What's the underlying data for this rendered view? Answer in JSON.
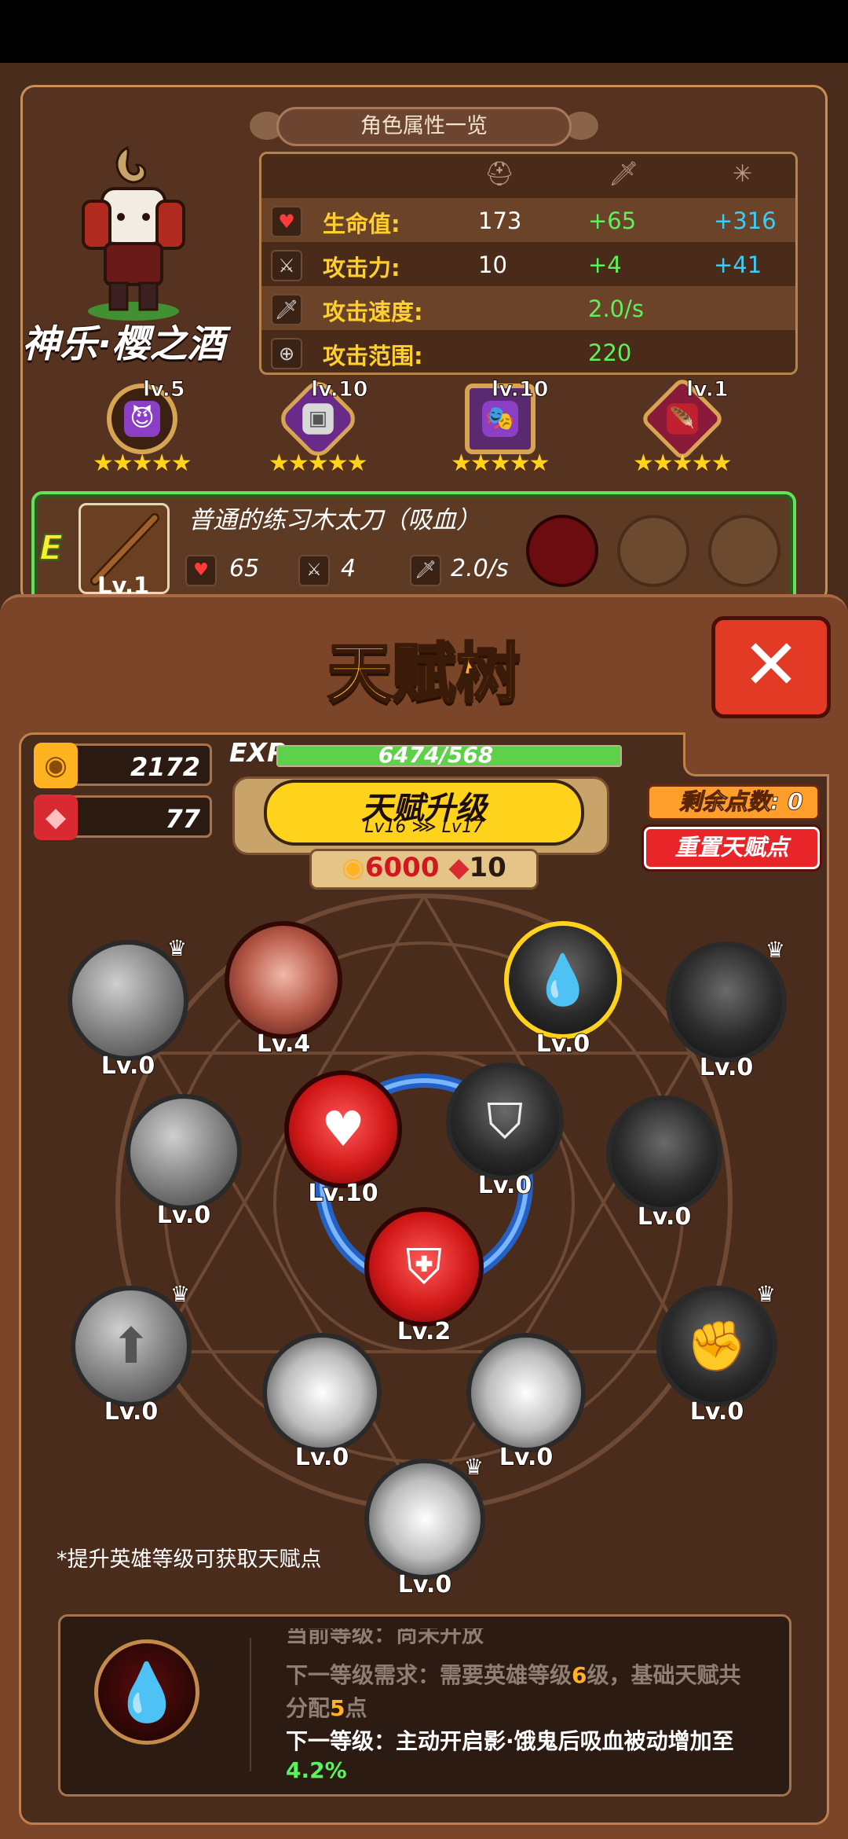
{
  "panel_title": "角色属性一览",
  "hero": {
    "name": "神乐·樱之酒"
  },
  "stats": [
    {
      "label": "生命值:",
      "base": "173",
      "bonus_green": "+65",
      "bonus_blue": "+316",
      "icon": "heart-icon"
    },
    {
      "label": "攻击力:",
      "base": "10",
      "bonus_green": "+4",
      "bonus_blue": "+41",
      "icon": "sword-icon"
    },
    {
      "label": "攻击速度:",
      "base": "",
      "bonus_green": "2.0/s",
      "bonus_blue": "",
      "icon": "sword-speed-icon"
    },
    {
      "label": "攻击范围:",
      "base": "",
      "bonus_green": "220",
      "bonus_blue": "",
      "icon": "crosshair-icon"
    }
  ],
  "equipment": [
    {
      "level": "lv.5",
      "stars": "★★★★★"
    },
    {
      "level": "lv.10",
      "stars": "★★★★★"
    },
    {
      "level": "lv.10",
      "stars": "★★★★★"
    },
    {
      "level": "lv.1",
      "stars": "★★★★★"
    }
  ],
  "weapon": {
    "grade": "E",
    "name": "普通的练习木太刀（吸血）",
    "level": "Lv.1",
    "hp": "65",
    "atk": "4",
    "speed": "2.0/s"
  },
  "talent": {
    "title": "天赋树",
    "close_label": "✕",
    "gold": "2172",
    "gems": "77",
    "exp_label": "EXP",
    "exp_text": "6474/568",
    "exp_fill": 1.0,
    "upgrade_title": "天赋升级",
    "upgrade_from": "Lv16",
    "upgrade_arrow": "⋙",
    "upgrade_to": "Lv17",
    "cost_gold": "6000",
    "cost_gems": "10",
    "remaining_label": "剩余点数:",
    "remaining_value": "0",
    "reset_label": "重置天赋点",
    "hint": "*提升英雄等级可获取天赋点"
  },
  "nodes": [
    {
      "id": "n1",
      "level": "Lv.0"
    },
    {
      "id": "n2",
      "level": "Lv.4"
    },
    {
      "id": "n3",
      "level": "Lv.0"
    },
    {
      "id": "n4",
      "level": "Lv.0"
    },
    {
      "id": "n5",
      "level": "Lv.0"
    },
    {
      "id": "n6",
      "level": "Lv.10"
    },
    {
      "id": "n7",
      "level": "Lv.0"
    },
    {
      "id": "n8",
      "level": "Lv.0"
    },
    {
      "id": "n9",
      "level": "Lv.2"
    },
    {
      "id": "n10",
      "level": "Lv.0"
    },
    {
      "id": "n11",
      "level": "Lv.0"
    },
    {
      "id": "n12",
      "level": "Lv.0"
    },
    {
      "id": "n13",
      "level": "Lv.0"
    },
    {
      "id": "n14",
      "level": "Lv.0"
    }
  ],
  "detail": {
    "line0": "当前等级：尚未开放",
    "line1_prefix": "下一等级需求：需要英雄等级",
    "line1_num": "6",
    "line1_mid": "级，基础天赋共",
    "line2_prefix": "分配",
    "line2_num": "5",
    "line2_suffix": "点",
    "line3": "下一等级：主动开启影·饿鬼后吸血被动增加至",
    "line4": "4.2%"
  },
  "colors": {
    "accent_gold": "#ffb12a",
    "exp_green": "#5ed04a",
    "stat_yellow": "#ffcf2e",
    "stat_blue": "#3ccdf5",
    "close_red": "#e23a24"
  }
}
